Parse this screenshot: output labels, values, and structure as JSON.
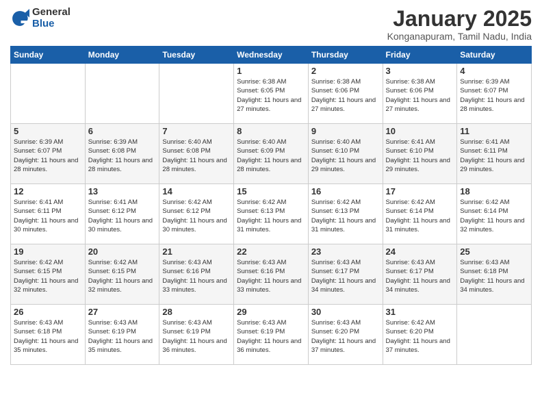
{
  "logo": {
    "general": "General",
    "blue": "Blue"
  },
  "header": {
    "month_year": "January 2025",
    "location": "Konganapuram, Tamil Nadu, India"
  },
  "weekdays": [
    "Sunday",
    "Monday",
    "Tuesday",
    "Wednesday",
    "Thursday",
    "Friday",
    "Saturday"
  ],
  "weeks": [
    [
      {
        "day": "",
        "info": ""
      },
      {
        "day": "",
        "info": ""
      },
      {
        "day": "",
        "info": ""
      },
      {
        "day": "1",
        "info": "Sunrise: 6:38 AM\nSunset: 6:05 PM\nDaylight: 11 hours\nand 27 minutes."
      },
      {
        "day": "2",
        "info": "Sunrise: 6:38 AM\nSunset: 6:06 PM\nDaylight: 11 hours\nand 27 minutes."
      },
      {
        "day": "3",
        "info": "Sunrise: 6:38 AM\nSunset: 6:06 PM\nDaylight: 11 hours\nand 27 minutes."
      },
      {
        "day": "4",
        "info": "Sunrise: 6:39 AM\nSunset: 6:07 PM\nDaylight: 11 hours\nand 28 minutes."
      }
    ],
    [
      {
        "day": "5",
        "info": "Sunrise: 6:39 AM\nSunset: 6:07 PM\nDaylight: 11 hours\nand 28 minutes."
      },
      {
        "day": "6",
        "info": "Sunrise: 6:39 AM\nSunset: 6:08 PM\nDaylight: 11 hours\nand 28 minutes."
      },
      {
        "day": "7",
        "info": "Sunrise: 6:40 AM\nSunset: 6:08 PM\nDaylight: 11 hours\nand 28 minutes."
      },
      {
        "day": "8",
        "info": "Sunrise: 6:40 AM\nSunset: 6:09 PM\nDaylight: 11 hours\nand 28 minutes."
      },
      {
        "day": "9",
        "info": "Sunrise: 6:40 AM\nSunset: 6:10 PM\nDaylight: 11 hours\nand 29 minutes."
      },
      {
        "day": "10",
        "info": "Sunrise: 6:41 AM\nSunset: 6:10 PM\nDaylight: 11 hours\nand 29 minutes."
      },
      {
        "day": "11",
        "info": "Sunrise: 6:41 AM\nSunset: 6:11 PM\nDaylight: 11 hours\nand 29 minutes."
      }
    ],
    [
      {
        "day": "12",
        "info": "Sunrise: 6:41 AM\nSunset: 6:11 PM\nDaylight: 11 hours\nand 30 minutes."
      },
      {
        "day": "13",
        "info": "Sunrise: 6:41 AM\nSunset: 6:12 PM\nDaylight: 11 hours\nand 30 minutes."
      },
      {
        "day": "14",
        "info": "Sunrise: 6:42 AM\nSunset: 6:12 PM\nDaylight: 11 hours\nand 30 minutes."
      },
      {
        "day": "15",
        "info": "Sunrise: 6:42 AM\nSunset: 6:13 PM\nDaylight: 11 hours\nand 31 minutes."
      },
      {
        "day": "16",
        "info": "Sunrise: 6:42 AM\nSunset: 6:13 PM\nDaylight: 11 hours\nand 31 minutes."
      },
      {
        "day": "17",
        "info": "Sunrise: 6:42 AM\nSunset: 6:14 PM\nDaylight: 11 hours\nand 31 minutes."
      },
      {
        "day": "18",
        "info": "Sunrise: 6:42 AM\nSunset: 6:14 PM\nDaylight: 11 hours\nand 32 minutes."
      }
    ],
    [
      {
        "day": "19",
        "info": "Sunrise: 6:42 AM\nSunset: 6:15 PM\nDaylight: 11 hours\nand 32 minutes."
      },
      {
        "day": "20",
        "info": "Sunrise: 6:42 AM\nSunset: 6:15 PM\nDaylight: 11 hours\nand 32 minutes."
      },
      {
        "day": "21",
        "info": "Sunrise: 6:43 AM\nSunset: 6:16 PM\nDaylight: 11 hours\nand 33 minutes."
      },
      {
        "day": "22",
        "info": "Sunrise: 6:43 AM\nSunset: 6:16 PM\nDaylight: 11 hours\nand 33 minutes."
      },
      {
        "day": "23",
        "info": "Sunrise: 6:43 AM\nSunset: 6:17 PM\nDaylight: 11 hours\nand 34 minutes."
      },
      {
        "day": "24",
        "info": "Sunrise: 6:43 AM\nSunset: 6:17 PM\nDaylight: 11 hours\nand 34 minutes."
      },
      {
        "day": "25",
        "info": "Sunrise: 6:43 AM\nSunset: 6:18 PM\nDaylight: 11 hours\nand 34 minutes."
      }
    ],
    [
      {
        "day": "26",
        "info": "Sunrise: 6:43 AM\nSunset: 6:18 PM\nDaylight: 11 hours\nand 35 minutes."
      },
      {
        "day": "27",
        "info": "Sunrise: 6:43 AM\nSunset: 6:19 PM\nDaylight: 11 hours\nand 35 minutes."
      },
      {
        "day": "28",
        "info": "Sunrise: 6:43 AM\nSunset: 6:19 PM\nDaylight: 11 hours\nand 36 minutes."
      },
      {
        "day": "29",
        "info": "Sunrise: 6:43 AM\nSunset: 6:19 PM\nDaylight: 11 hours\nand 36 minutes."
      },
      {
        "day": "30",
        "info": "Sunrise: 6:43 AM\nSunset: 6:20 PM\nDaylight: 11 hours\nand 37 minutes."
      },
      {
        "day": "31",
        "info": "Sunrise: 6:42 AM\nSunset: 6:20 PM\nDaylight: 11 hours\nand 37 minutes."
      },
      {
        "day": "",
        "info": ""
      }
    ]
  ]
}
